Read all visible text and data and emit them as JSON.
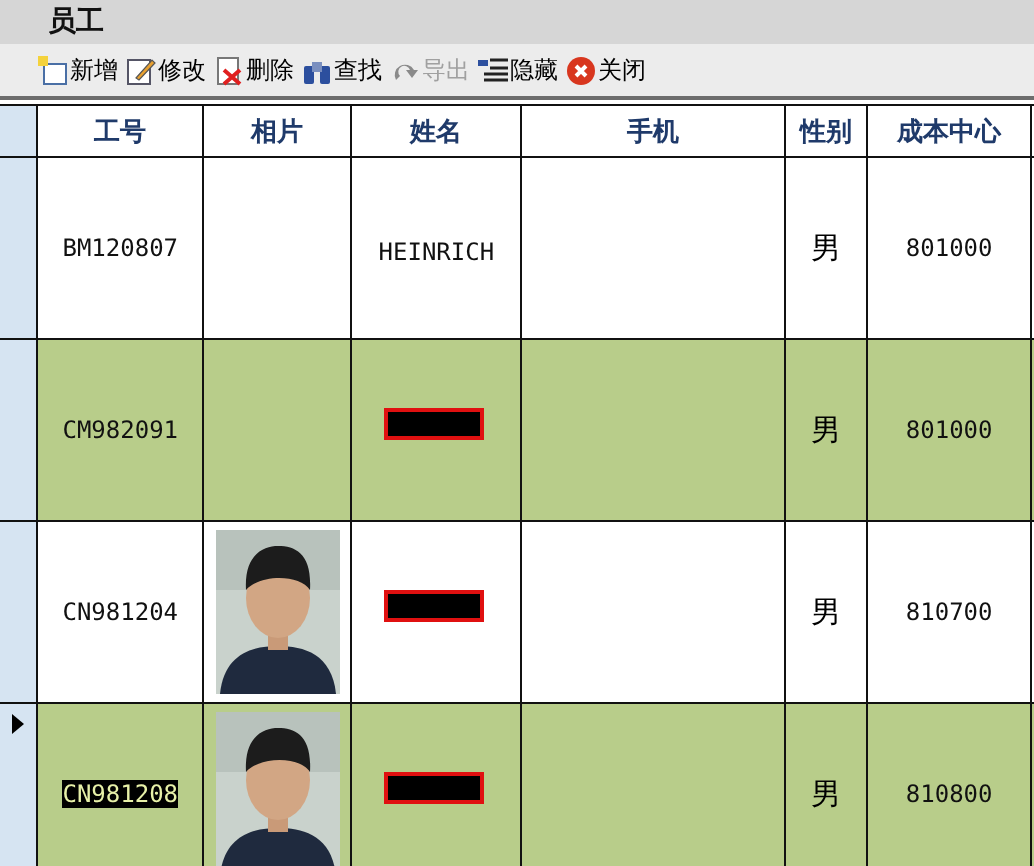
{
  "window": {
    "title": "员工"
  },
  "toolbar": [
    {
      "label": "新增",
      "kind": "new",
      "disabled": false
    },
    {
      "label": "修改",
      "kind": "edit",
      "disabled": false
    },
    {
      "label": "删除",
      "kind": "delete",
      "disabled": false
    },
    {
      "label": "查找",
      "kind": "find",
      "disabled": false
    },
    {
      "label": "导出",
      "kind": "export",
      "disabled": true
    },
    {
      "label": "隐藏",
      "kind": "hide",
      "disabled": false
    },
    {
      "label": "关闭",
      "kind": "close",
      "disabled": false
    }
  ],
  "table": {
    "columns": [
      "工号",
      "相片",
      "姓名",
      "手机",
      "性别",
      "成本中心"
    ],
    "rows": [
      {
        "id": "BM120807",
        "photo": false,
        "name": "HEINRICH",
        "redacted": false,
        "gender": "男",
        "cost_center": "801000",
        "shaded": false,
        "selected": false
      },
      {
        "id": "CM982091",
        "photo": false,
        "redacted": true,
        "gender": "男",
        "cost_center": "801000",
        "shaded": true,
        "selected": false
      },
      {
        "id": "CN981204",
        "photo": true,
        "redacted": true,
        "gender": "男",
        "cost_center": "810700",
        "shaded": false,
        "selected": false
      },
      {
        "id": "CN981208",
        "photo": true,
        "redacted": true,
        "gender": "男",
        "cost_center": "810800",
        "shaded": true,
        "selected": true
      }
    ]
  }
}
